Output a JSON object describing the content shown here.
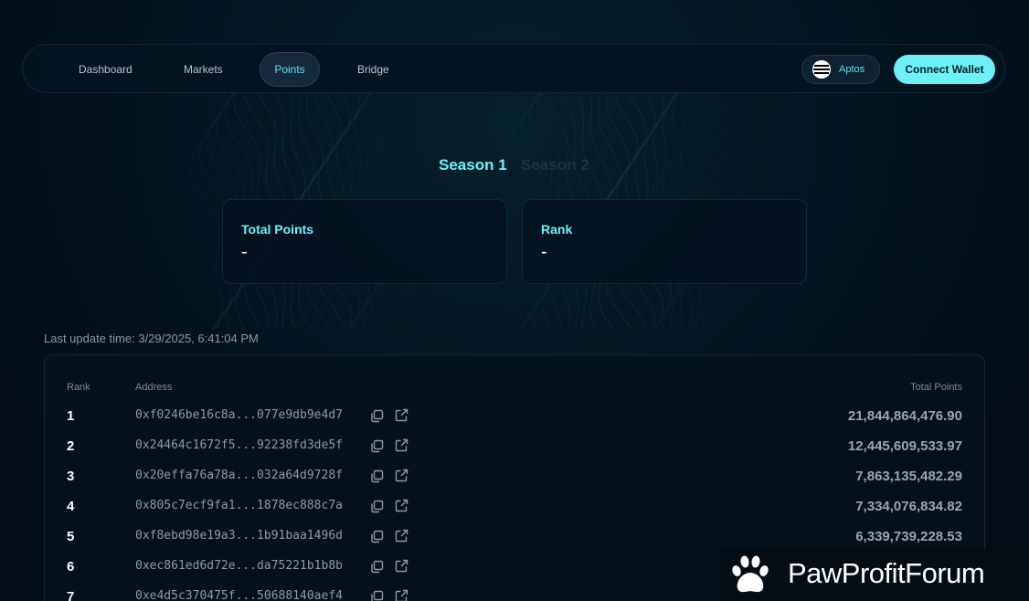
{
  "nav": {
    "tabs": [
      {
        "label": "Dashboard",
        "active": false
      },
      {
        "label": "Markets",
        "active": false
      },
      {
        "label": "Points",
        "active": true
      },
      {
        "label": "Bridge",
        "active": false
      }
    ],
    "chain": {
      "label": "Aptos",
      "icon": "aptos-logo-icon"
    },
    "connect_label": "Connect Wallet"
  },
  "seasons": [
    {
      "label": "Season 1",
      "active": true
    },
    {
      "label": "Season 2",
      "active": false
    }
  ],
  "stats": {
    "total_points": {
      "label": "Total Points",
      "value": "-"
    },
    "rank": {
      "label": "Rank",
      "value": "-"
    }
  },
  "leaderboard": {
    "update_time": "Last update time: 3/29/2025, 6:41:04 PM",
    "headers": {
      "rank": "Rank",
      "address": "Address",
      "points": "Total Points"
    },
    "rows": [
      {
        "rank": "1",
        "address": "0xf0246be16c8a...077e9db9e4d7",
        "points": "21,844,864,476.90"
      },
      {
        "rank": "2",
        "address": "0x24464c1672f5...92238fd3de5f",
        "points": "12,445,609,533.97"
      },
      {
        "rank": "3",
        "address": "0x20effa76a78a...032a64d9728f",
        "points": "7,863,135,482.29"
      },
      {
        "rank": "4",
        "address": "0x805c7ecf9fa1...1878ec888c7a",
        "points": "7,334,076,834.82"
      },
      {
        "rank": "5",
        "address": "0xf8ebd98e19a3...1b91baa1496d",
        "points": "6,339,739,228.53"
      },
      {
        "rank": "6",
        "address": "0xec861ed6d72e...da75221b1b8b",
        "points": ""
      },
      {
        "rank": "7",
        "address": "0xe4d5c370475f...50688140aef4",
        "points": ""
      }
    ]
  },
  "watermark": {
    "text": "PawProfitForum",
    "icon": "paw-icon"
  },
  "colors": {
    "accent": "#6df0f8",
    "background": "#020d17",
    "card": "#03121e",
    "muted": "#8f9ba6"
  }
}
